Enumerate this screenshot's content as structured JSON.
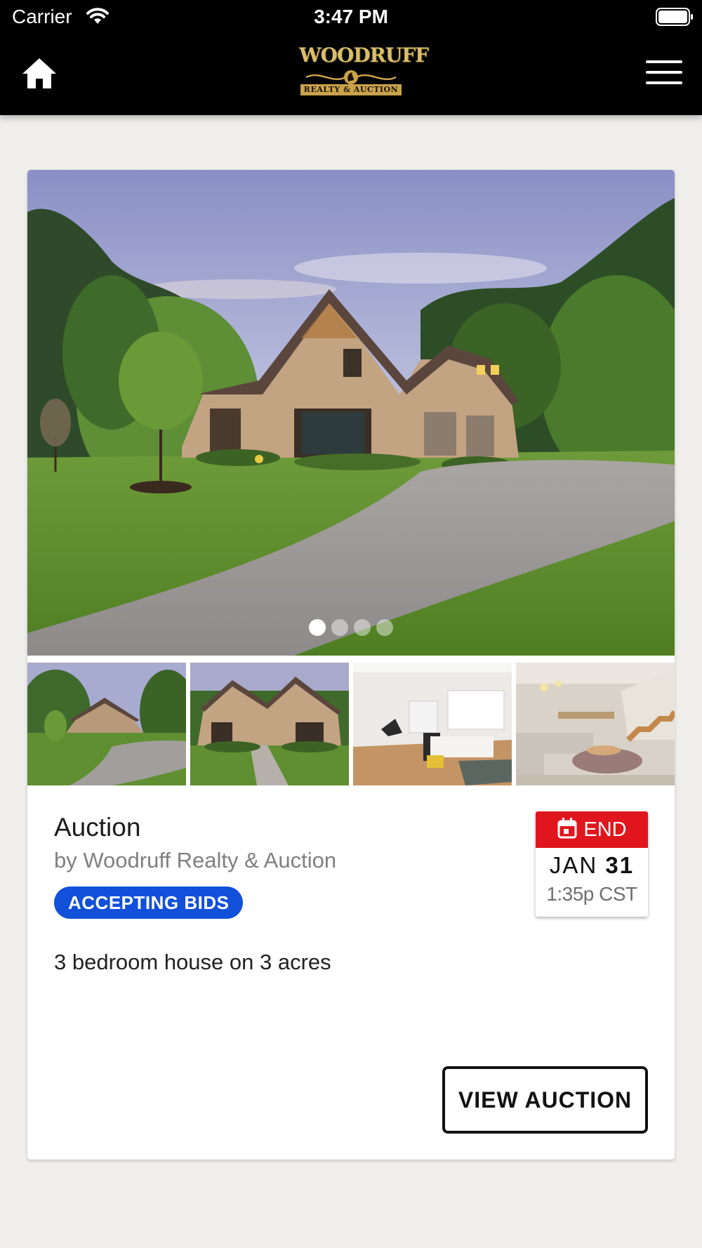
{
  "status_bar": {
    "carrier": "Carrier",
    "time": "3:47 PM"
  },
  "nav": {
    "logo_word": "WOODRUFF",
    "logo_tagline": "REALTY & AUCTION"
  },
  "listing": {
    "title": "Auction",
    "byline": "by Woodruff Realty & Auction",
    "status_badge": "ACCEPTING BIDS",
    "description": "3 bedroom house on 3 acres",
    "end_label": "END",
    "end_month": "JAN",
    "end_day": "31",
    "end_time": "1:35p CST",
    "view_button": "VIEW AUCTION",
    "carousel": {
      "total_slides": 4,
      "active_slide": 1
    },
    "thumbnails": [
      "house-exterior-wide",
      "house-front-walkway",
      "living-room-bright",
      "living-room-modern"
    ]
  },
  "colors": {
    "badge_blue": "#1250d9",
    "end_red": "#e0151d",
    "nav_black": "#000000",
    "background": "#efeeeb"
  }
}
